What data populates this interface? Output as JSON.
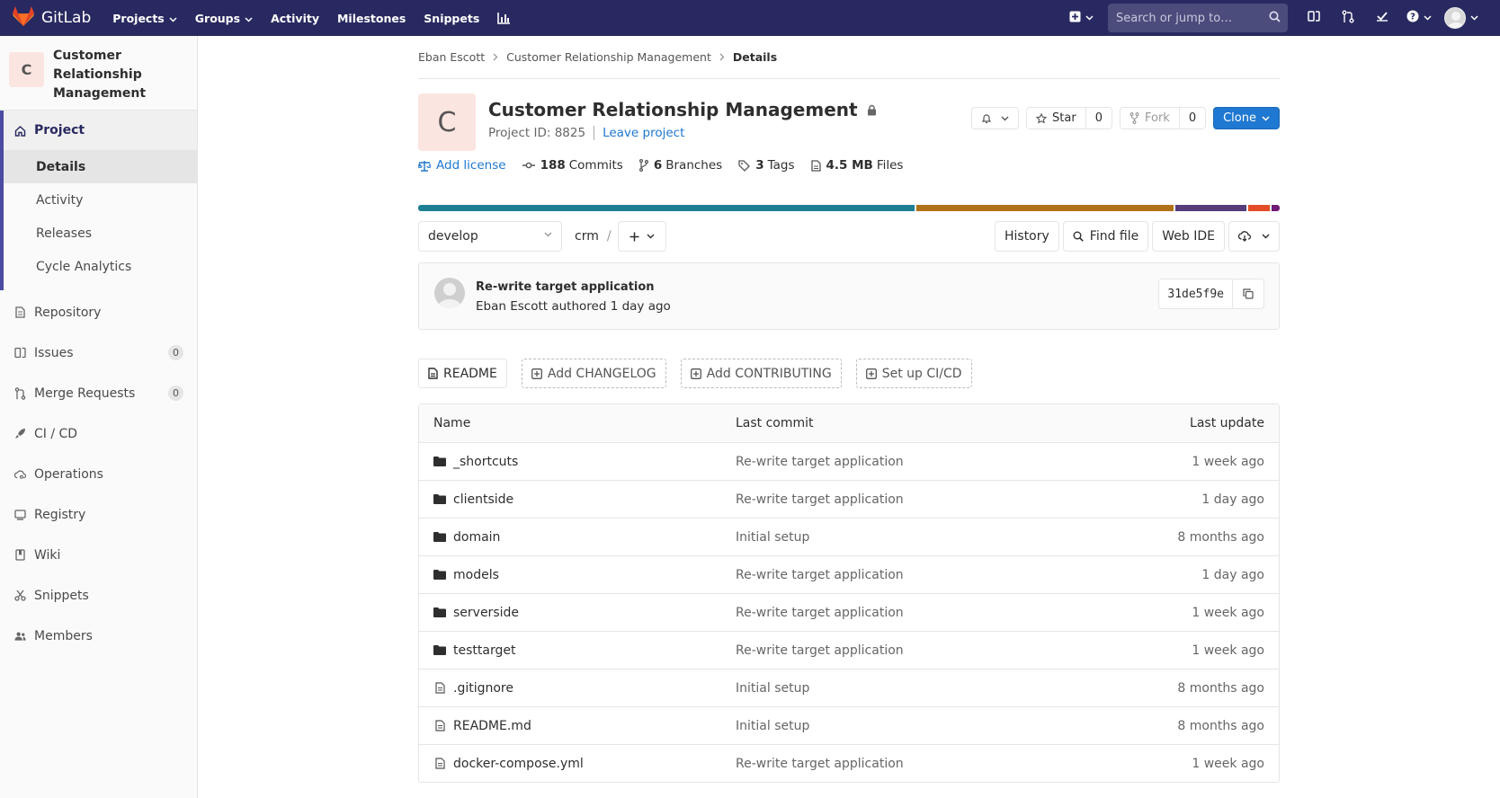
{
  "navbar": {
    "brand": "GitLab",
    "links": [
      {
        "label": "Projects",
        "dropdown": true
      },
      {
        "label": "Groups",
        "dropdown": true
      },
      {
        "label": "Activity",
        "dropdown": false
      },
      {
        "label": "Milestones",
        "dropdown": false
      },
      {
        "label": "Snippets",
        "dropdown": false
      }
    ],
    "search_placeholder": "Search or jump to…"
  },
  "sidebar": {
    "context_initial": "C",
    "context_title": "Customer Relationship Management",
    "project_label": "Project",
    "project_subitems": [
      {
        "label": "Details",
        "active": true
      },
      {
        "label": "Activity",
        "active": false
      },
      {
        "label": "Releases",
        "active": false
      },
      {
        "label": "Cycle Analytics",
        "active": false
      }
    ],
    "items": [
      {
        "label": "Repository",
        "icon": "repository-icon"
      },
      {
        "label": "Issues",
        "icon": "issues-icon",
        "badge": "0"
      },
      {
        "label": "Merge Requests",
        "icon": "merge-request-icon",
        "badge": "0"
      },
      {
        "label": "CI / CD",
        "icon": "rocket-icon"
      },
      {
        "label": "Operations",
        "icon": "cloud-gear-icon"
      },
      {
        "label": "Registry",
        "icon": "disk-icon"
      },
      {
        "label": "Wiki",
        "icon": "book-icon"
      },
      {
        "label": "Snippets",
        "icon": "scissors-icon"
      },
      {
        "label": "Members",
        "icon": "users-icon"
      }
    ]
  },
  "breadcrumb": {
    "items": [
      "Eban Escott",
      "Customer Relationship Management",
      "Details"
    ]
  },
  "project": {
    "initial": "C",
    "title": "Customer Relationship Management",
    "id_label": "Project ID: 8825",
    "leave_label": "Leave project",
    "star_label": "Star",
    "star_count": "0",
    "fork_label": "Fork",
    "fork_count": "0",
    "clone_label": "Clone"
  },
  "stats": {
    "license": "Add license",
    "commits_count": "188",
    "commits_label": "Commits",
    "branches_count": "6",
    "branches_label": "Branches",
    "tags_count": "3",
    "tags_label": "Tags",
    "files_size": "4.5 MB",
    "files_label": "Files"
  },
  "language_bar": [
    {
      "color": "#1e7f93",
      "percent": 57.9
    },
    {
      "color": "#b07219",
      "percent": 30.0
    },
    {
      "color": "#563d7c",
      "percent": 8.3
    },
    {
      "color": "#e34c26",
      "percent": 2.6
    },
    {
      "color": "#701a76",
      "percent": 0.9
    }
  ],
  "tree": {
    "branch": "develop",
    "path": "crm",
    "history": "History",
    "find_file": "Find file",
    "web_ide": "Web IDE"
  },
  "last_commit": {
    "title": "Re-write target application",
    "meta": "Eban Escott authored 1 day ago",
    "sha": "31de5f9e"
  },
  "quick_actions": [
    {
      "label": "README",
      "style": "solid"
    },
    {
      "label": "Add CHANGELOG",
      "style": "dashed"
    },
    {
      "label": "Add CONTRIBUTING",
      "style": "dashed"
    },
    {
      "label": "Set up CI/CD",
      "style": "dashed"
    }
  ],
  "table": {
    "headers": {
      "name": "Name",
      "commit": "Last commit",
      "date": "Last update"
    },
    "rows": [
      {
        "name": "_shortcuts",
        "type": "folder",
        "commit": "Re-write target application",
        "date": "1 week ago"
      },
      {
        "name": "clientside",
        "type": "folder",
        "commit": "Re-write target application",
        "date": "1 day ago"
      },
      {
        "name": "domain",
        "type": "folder",
        "commit": "Initial setup",
        "date": "8 months ago"
      },
      {
        "name": "models",
        "type": "folder",
        "commit": "Re-write target application",
        "date": "1 day ago"
      },
      {
        "name": "serverside",
        "type": "folder",
        "commit": "Re-write target application",
        "date": "1 week ago"
      },
      {
        "name": "testtarget",
        "type": "folder",
        "commit": "Re-write target application",
        "date": "1 week ago"
      },
      {
        "name": ".gitignore",
        "type": "file",
        "commit": "Initial setup",
        "date": "8 months ago"
      },
      {
        "name": "README.md",
        "type": "file",
        "commit": "Initial setup",
        "date": "8 months ago"
      },
      {
        "name": "docker-compose.yml",
        "type": "file",
        "commit": "Re-write target application",
        "date": "1 week ago"
      }
    ]
  }
}
